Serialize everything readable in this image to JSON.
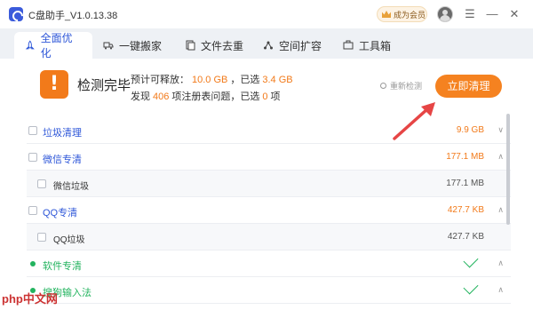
{
  "window": {
    "title": "C盘助手_V1.0.13.38"
  },
  "titlebar": {
    "vip_label": "成为会员"
  },
  "tabs": [
    {
      "label": "全面优化",
      "icon": "rocket-icon"
    },
    {
      "label": "一键搬家",
      "icon": "truck-icon"
    },
    {
      "label": "文件去重",
      "icon": "files-icon"
    },
    {
      "label": "空间扩容",
      "icon": "nodes-icon"
    },
    {
      "label": "工具箱",
      "icon": "toolbox-icon"
    }
  ],
  "summary": {
    "status": "检测完毕",
    "line1_prefix": "预计可释放：",
    "line1_value": "10.0 GB",
    "line1_mid": "，已选",
    "line1_selected": "3.4 GB",
    "line2_prefix": "发现",
    "line2_value": "406",
    "line2_mid": "项注册表问题，已选",
    "line2_selected": "0",
    "line2_suffix": "项",
    "recheck": "重新检测",
    "clean_button": "立即清理"
  },
  "list": [
    {
      "label": "垃圾清理",
      "size": "9.9 GB"
    },
    {
      "label": "微信专清",
      "size": "177.1 MB"
    },
    {
      "label": "微信垃圾",
      "size": "177.1 MB"
    },
    {
      "label": "QQ专清",
      "size": "427.7 KB"
    },
    {
      "label": "QQ垃圾",
      "size": "427.7 KB"
    },
    {
      "label": "软件专清"
    },
    {
      "label": "搜狗输入法"
    }
  ],
  "watermark": "php中文网",
  "colors": {
    "accent": "#f58220",
    "brand_blue": "#2d56d8",
    "ok_green": "#22b35e"
  }
}
